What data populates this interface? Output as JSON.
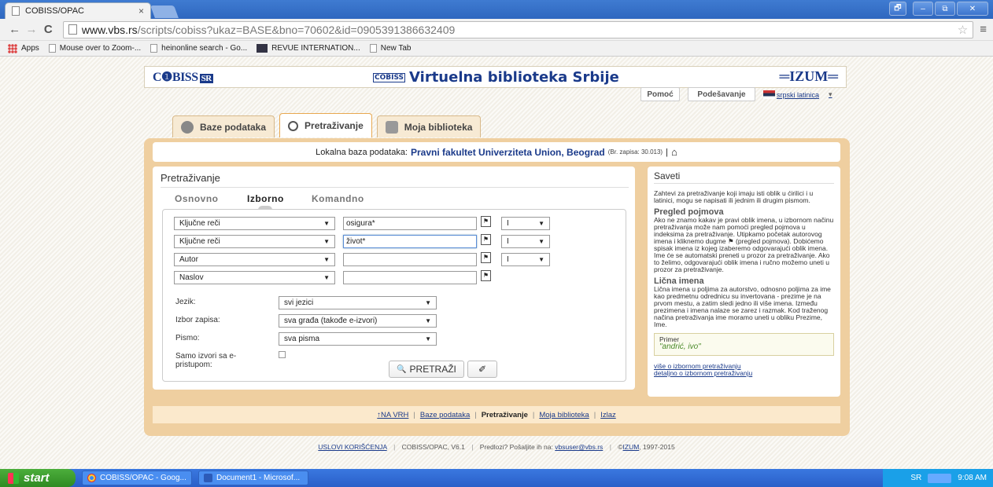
{
  "browser": {
    "tab_title": "COBISS/OPAC",
    "tab_close": "×",
    "window_controls": [
      "🗗",
      "–",
      "⧉",
      "✕"
    ],
    "url_host": "www.vbs.rs",
    "url_path": "/scripts/cobiss?ukaz=BASE&bno=70602&id=0905391386632409",
    "nav": {
      "back": "←",
      "forward": "→",
      "reload": "C",
      "star": "☆",
      "menu": "≡"
    },
    "bookmarks": [
      "Apps",
      "Mouse over to Zoom-...",
      "heinonline search - Go...",
      "REVUE INTERNATION...",
      "New Tab"
    ]
  },
  "header": {
    "cobiss_logo": "C❶BISS",
    "cobiss_sr": "SR",
    "site_title": "Virtuelna biblioteka Srbije",
    "mini_logo": "COBISS",
    "izum": "═IZUM═",
    "help_button": "Pomoć",
    "settings_button": "Podešavanje",
    "language": "srpski latinica",
    "language_arrow": "▾"
  },
  "tabs": [
    {
      "label": "Baze podataka",
      "active": false
    },
    {
      "label": "Pretraživanje",
      "active": true
    },
    {
      "label": "Moja biblioteka",
      "active": false
    }
  ],
  "infobar": {
    "prefix": "Lokalna baza podataka:",
    "library": "Pravni fakultet Univerziteta Union, Beograd",
    "count": "(Br. zapisa: 30.013)",
    "separator": "|",
    "home_icon": "⌂"
  },
  "search": {
    "title": "Pretraživanje",
    "subtabs": [
      "Osnovno",
      "Izborno",
      "Komandno"
    ],
    "active_subtab": "Izborno",
    "rows": [
      {
        "field": "Ključne reči",
        "value": "osigura*",
        "op": "I"
      },
      {
        "field": "Ključne reči",
        "value": "život*",
        "op": "I"
      },
      {
        "field": "Autor",
        "value": "",
        "op": "I"
      },
      {
        "field": "Naslov",
        "value": "",
        "op": ""
      }
    ],
    "arrow": "▼",
    "flag_glyph": "⚑",
    "filters": [
      {
        "label": "Jezik:",
        "value": "svi jezici"
      },
      {
        "label": "Izbor zapisa:",
        "value": "sva građa (takođe e-izvori)"
      },
      {
        "label": "Pismo:",
        "value": "sva pisma"
      }
    ],
    "eonly_label_1": "Samo izvori sa e-",
    "eonly_label_2": "pristupom:",
    "search_button": "PRETRAŽI",
    "search_icon": "🔍",
    "clear_icon": "✐"
  },
  "tips": {
    "title": "Saveti",
    "intro": "Zahtevi za pretraživanje koji imaju isti oblik u ćirilici i u latinici, mogu se napisati ili jednim ili drugim pismom.",
    "h_pregled": "Pregled pojmova",
    "p_pregled": "Ako ne znamo kakav je pravi oblik imena, u izbornom načinu pretraživanja može nam pomoći pregled pojmova u indeksima za pretraživanje. Utipkamo početak autorovog imena i kliknemo dugme ⚑ (pregled pojmova). Dobićemo spisak imena iz kojeg izaberemo odgovarajući oblik imena. Ime će se automatski preneti u prozor za pretraživanje. Ako to želimo, odgovarajući oblik imena i ručno možemo uneti u prozor za pretraživanje.",
    "h_licna": "Lična imena",
    "p_licna": "Lična imena u poljima za autorstvo, odnosno poljima za ime kao predmetnu odrednicu su invertovana - prezime je na prvom mestu, a zatim sledi jedno ili više imena. Između prezimena i imena nalaze se zarez i razmak. Kod traženog načina pretraživanja ime moramo uneti u obliku Prezime, Ime.",
    "example_label": "Primer",
    "example_value": "\"andrić, ivo\"",
    "link1": "više o izbornom pretraživanju",
    "link2": "detaljno o izbornom pretraživanju"
  },
  "footer_nav": {
    "top": "↑NA VRH",
    "sep": "|",
    "items": [
      "Baze podataka",
      "Pretraživanje",
      "Moja biblioteka",
      "Izlaz"
    ]
  },
  "copyright": {
    "terms": "USLOVI KORIŠĆENJA",
    "sep": "|",
    "version": "COBISS/OPAC, V6.1",
    "prompt": "Predlozi? Pošaljite ih na:",
    "email": "vbsuser@vbs.rs",
    "izum_prefix": "©",
    "izum": "IZUM",
    "years": ", 1997-2015"
  },
  "taskbar": {
    "start": "start",
    "items": [
      "COBISS/OPAC - Goog...",
      "Document1 - Microsof..."
    ],
    "lang": "SR",
    "time": "9:08 AM"
  }
}
